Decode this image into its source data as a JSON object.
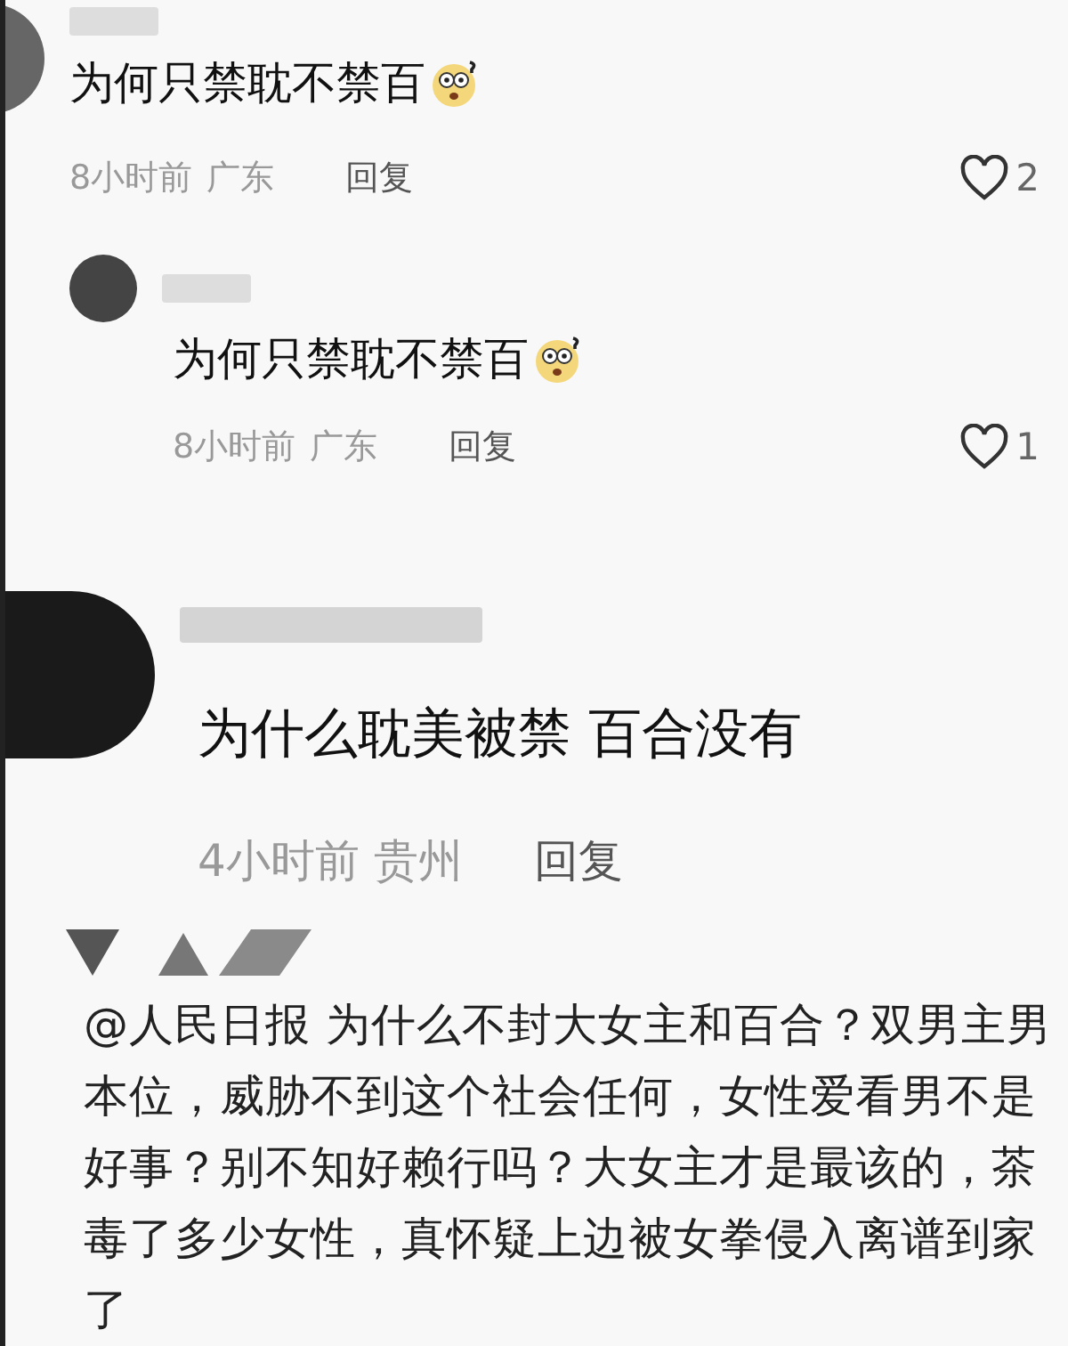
{
  "comments": [
    {
      "kind": "comment",
      "text": "为何只禁耽不禁百",
      "emoji": true,
      "time": "8小时前",
      "location": "广东",
      "reply": "回复",
      "likes": "2",
      "liked": false
    },
    {
      "kind": "reply",
      "text": "为何只禁耽不禁百",
      "emoji": true,
      "time": "8小时前",
      "location": "广东",
      "reply": "回复",
      "likes": "1",
      "liked": false
    },
    {
      "kind": "large",
      "text": "为什么耽美被禁 百合没有",
      "emoji": false,
      "time": "4小时前",
      "location": "贵州",
      "reply": "回复"
    }
  ],
  "post": {
    "text": "@人民日报 为什么不封大女主和百合？双男主男本位，威胁不到这个社会任何，女性爱看男不是好事？别不知好赖行吗？大女主才是最该的，茶毒了多少女性，真怀疑上边被女拳侵入离谱到家了"
  }
}
